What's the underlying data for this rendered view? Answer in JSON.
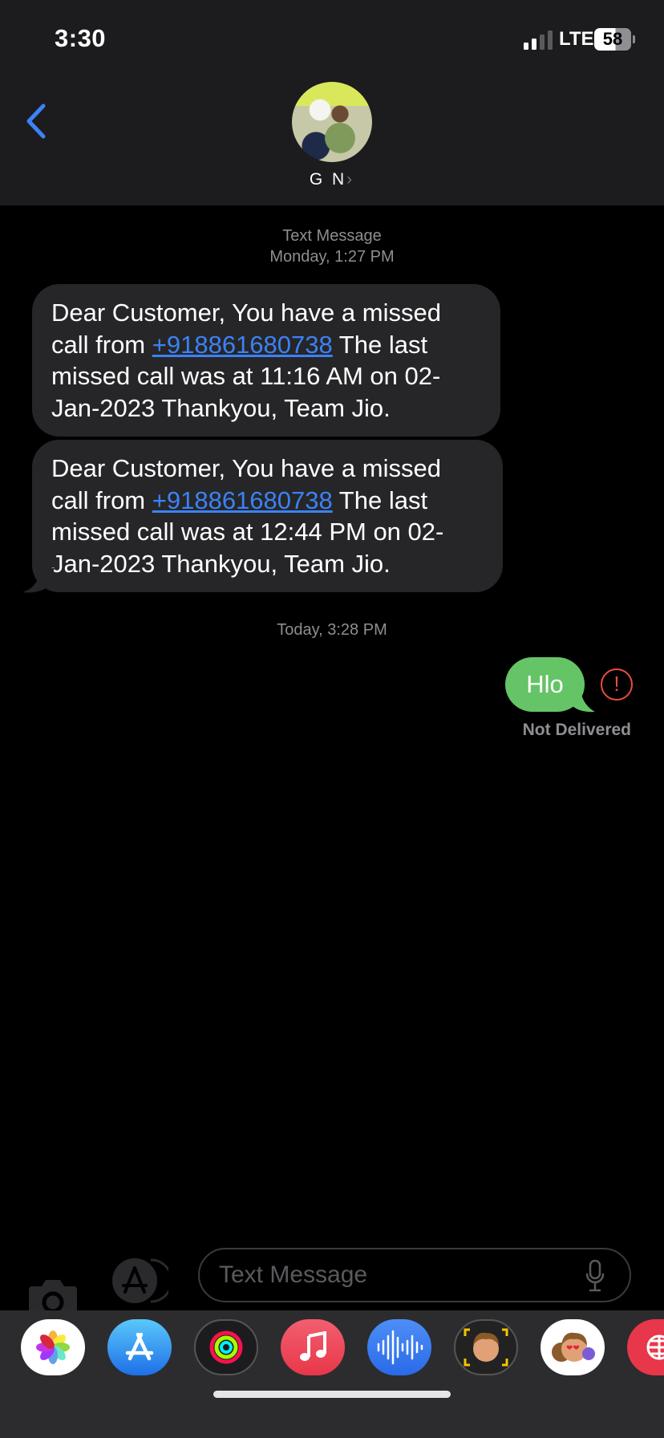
{
  "status_bar": {
    "time": "3:30",
    "network": "LTE",
    "battery": "58"
  },
  "header": {
    "contact_name": "G N",
    "chevron": "›"
  },
  "conversation": {
    "header_label": "Text Message",
    "first_timestamp": "Monday, 1:27 PM",
    "messages": [
      {
        "before": "Dear Customer, You have a missed call from ",
        "link": "+918861680738",
        "after": " The last missed call was at 11:16 AM on 02-Jan-2023 Thankyou, Team Jio."
      },
      {
        "before": "Dear Customer, You have a missed call from ",
        "link": "+918861680738",
        "after": " The last missed call was at 12:44 PM on 02-Jan-2023 Thankyou, Team Jio."
      }
    ],
    "second_timestamp": "Today, 3:28 PM",
    "sent": {
      "text": "Hlo",
      "status": "Not Delivered",
      "alert_glyph": "!"
    }
  },
  "input": {
    "placeholder": "Text Message"
  },
  "dock": {
    "apps": [
      "photos",
      "app-store",
      "activity",
      "music",
      "voice-memo",
      "memoji",
      "animoji",
      "web-search"
    ]
  },
  "colors": {
    "link": "#3b82f6",
    "sent_bubble": "#65c466",
    "received_bubble": "#262628",
    "alert": "#eb4d3d",
    "back": "#3b82f6"
  }
}
